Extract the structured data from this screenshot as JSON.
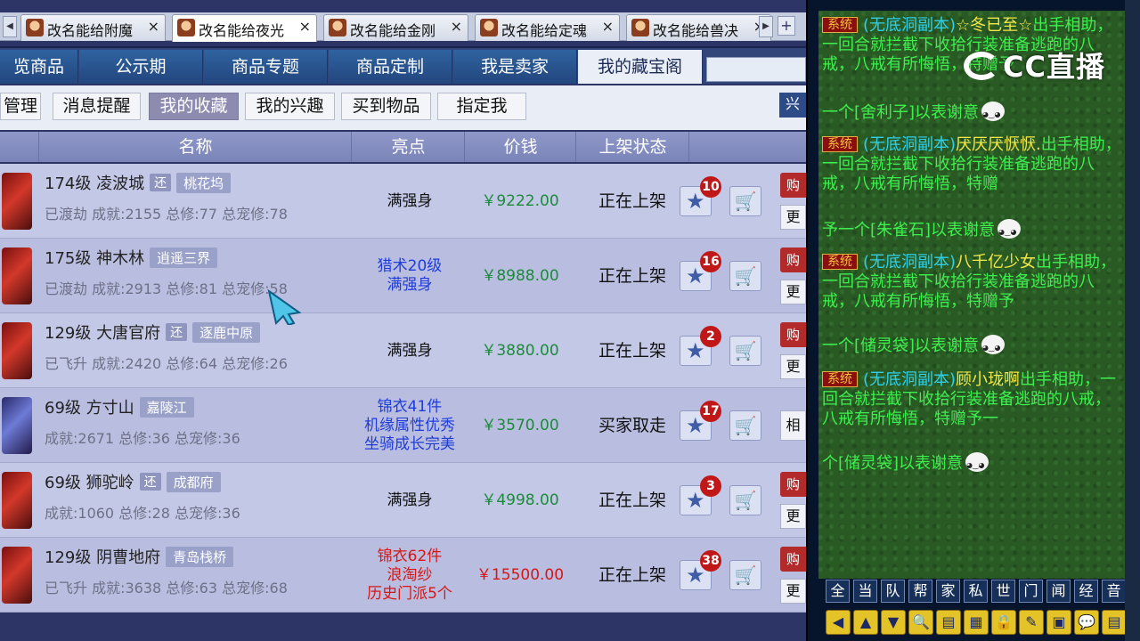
{
  "window_tabs": [
    {
      "label": "改名能给附魔",
      "close": "×"
    },
    {
      "label": "改名能给夜光",
      "close": "×"
    },
    {
      "label": "改名能给金刚",
      "close": "×"
    },
    {
      "label": "改名能给定魂",
      "close": "×"
    },
    {
      "label": "改名能给兽决",
      "close": "×"
    }
  ],
  "tab_controls": {
    "left": "◀",
    "right": "▶",
    "add": "+"
  },
  "category_tabs": [
    "览商品",
    "公示期",
    "商品专题",
    "商品定制",
    "我是卖家",
    "我的藏宝阁"
  ],
  "sub_tabs": [
    "管理",
    "消息提醒",
    "我的收藏",
    "我的兴趣",
    "买到物品",
    "指定我"
  ],
  "sub_side_label": "兴",
  "table_headers": {
    "name": "名称",
    "highlight": "亮点",
    "price": "价钱",
    "status": "上架状态"
  },
  "rows": [
    {
      "level": "174级",
      "school": "凌波城",
      "huan": "还",
      "server": "桃花坞",
      "line2": "已渡劫 成就:2155 总修:77 总宠修:78",
      "highlight": [
        "满强身"
      ],
      "price": "￥9222.00",
      "price_color": "#1c8a3a",
      "status": "正在上架",
      "favorites": "10",
      "buy": "购",
      "more": "更"
    },
    {
      "level": "175级",
      "school": "神木林",
      "huan": "",
      "server": "逍遥三界",
      "line2": "已渡劫 成就:2913 总修:81 总宠修:58",
      "highlight": [
        "猎术20级",
        "满强身"
      ],
      "price": "￥8988.00",
      "price_color": "#1c8a3a",
      "status": "正在上架",
      "favorites": "16",
      "buy": "购",
      "more": "更"
    },
    {
      "level": "129级",
      "school": "大唐官府",
      "huan": "还",
      "server": "逐鹿中原",
      "line2": "已飞升 成就:2420 总修:64 总宠修:26",
      "highlight": [
        "满强身"
      ],
      "price": "￥3880.00",
      "price_color": "#1c8a3a",
      "status": "正在上架",
      "favorites": "2",
      "buy": "购",
      "more": "更"
    },
    {
      "level": "69级",
      "school": "方寸山",
      "huan": "",
      "server": "嘉陵江",
      "line2": "成就:2671 总修:36 总宠修:36",
      "highlight": [
        "锦衣41件",
        "机缘属性优秀",
        "坐骑成长完美"
      ],
      "price": "￥3570.00",
      "price_color": "#1c8a3a",
      "status": "买家取走",
      "favorites": "17",
      "side": "相"
    },
    {
      "level": "69级",
      "school": "狮驼岭",
      "huan": "还",
      "server": "成都府",
      "line2": "成就:1060 总修:28 总宠修:36",
      "highlight": [
        "满强身"
      ],
      "price": "￥4998.00",
      "price_color": "#1c8a3a",
      "status": "正在上架",
      "favorites": "3",
      "buy": "购",
      "more": "更"
    },
    {
      "level": "129级",
      "school": "阴曹地府",
      "huan": "",
      "server": "青岛栈桥",
      "line2": "已飞升 成就:3638 总修:63 总宠修:68",
      "highlight": [
        "锦衣62件",
        "浪淘纱",
        "历史门派5个"
      ],
      "price": "￥15500.00",
      "price_color": "#d41818",
      "status": "正在上架",
      "favorites": "38",
      "buy": "购",
      "more": "更"
    }
  ],
  "highlight_colors": [
    "#111111",
    "#1f3cd8",
    "#111111",
    "#1f3cd8",
    "#111111",
    "#d41818"
  ],
  "chat": {
    "sys_tag": "系统",
    "messages": [
      {
        "pre": "(无底洞副本)",
        "name": "☆冬已至☆",
        "body": "出手相助，一回合就拦截下收拾行装准备逃跑的八戒，八戒有所悔悟，特赠予",
        "tail": "一个[舍利子]以表谢意"
      },
      {
        "pre": "(无底洞副本)",
        "name": "厌厌厌恹恹.",
        "body": "出手相助，一回合就拦截下收拾行装准备逃跑的八戒，八戒有所悔悟，特赠",
        "tail": "予一个[朱雀石]以表谢意"
      },
      {
        "pre": "(无底洞副本)",
        "name": "八千亿少女",
        "body": "出手相助，一回合就拦截下收拾行装准备逃跑的八戒，八戒有所悔悟，特赠予",
        "tail": "一个[储灵袋]以表谢意"
      },
      {
        "pre": "(无底洞副本)",
        "name": "顾小珑啊",
        "body": "出手相助，一回合就拦截下收拾行装准备逃跑的八戒，八戒有所悔悟，特赠予一",
        "tail": "个[储灵袋]以表谢意"
      }
    ],
    "logo_text": "CC直播"
  },
  "channels": [
    "全",
    "当",
    "队",
    "帮",
    "家",
    "私",
    "世",
    "门",
    "闻",
    "经",
    "音"
  ],
  "tools": [
    "◀",
    "▲",
    "▼",
    "🔍",
    "▤",
    "▦",
    "🔒",
    "✎",
    "▣",
    "💬",
    "▤"
  ]
}
